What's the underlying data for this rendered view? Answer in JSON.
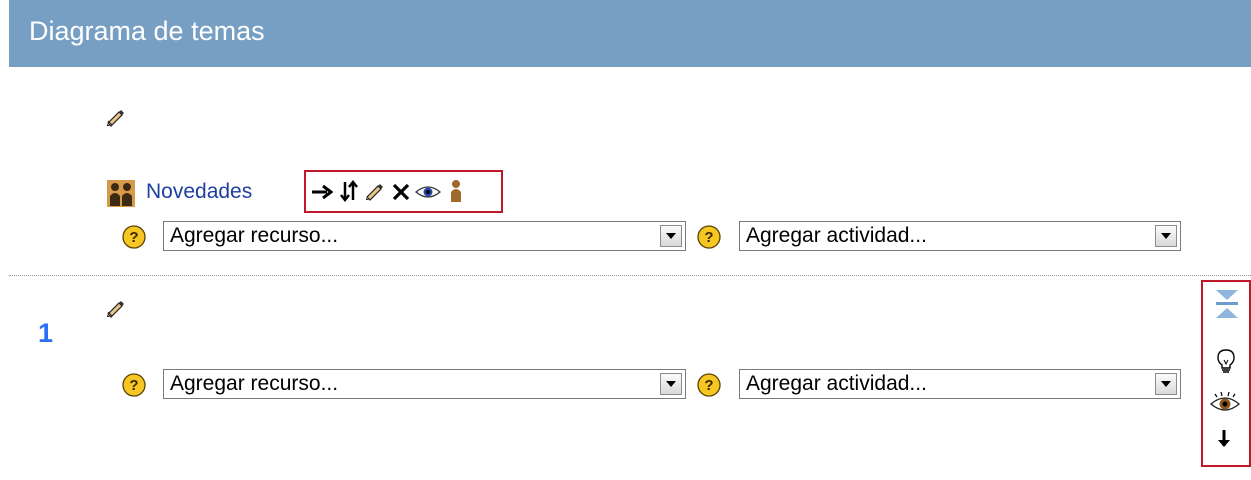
{
  "header": {
    "title": "Diagrama de temas"
  },
  "topic0": {
    "forum_link": "Novedades",
    "add_resource": "Agregar recurso...",
    "add_activity": "Agregar actividad...",
    "tool_icons": [
      "arrow-right-icon",
      "move-updown-icon",
      "edit-icon",
      "delete-icon",
      "eye-icon",
      "role-person-icon"
    ]
  },
  "topic1": {
    "number": "1",
    "add_resource": "Agregar recurso...",
    "add_activity": "Agregar actividad...",
    "side_icons": [
      "show-only-this-topic-icon",
      "highlight-lightbulb-icon",
      "eye-icon",
      "move-down-icon"
    ]
  },
  "colors": {
    "header_bg": "#779fc3",
    "link": "#1f3f9f",
    "section_number": "#2a6ff5",
    "highlight_border": "#c0182b"
  }
}
